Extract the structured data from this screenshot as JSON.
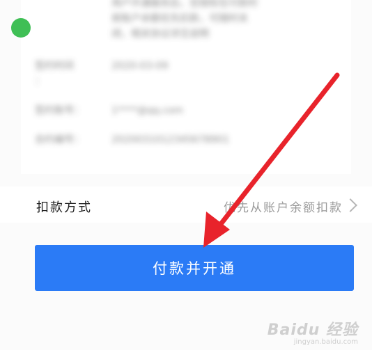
{
  "info_rows": [
    {
      "label": "",
      "value": "用户开通服务后，您授权在付款时\n按账户余额优先扣款，可随时关\n闭，相关协议详见说明"
    },
    {
      "label": "签约时间\n：",
      "value": "2020-03-09"
    },
    {
      "label": "签约账号：",
      "value": "1****@qq.com"
    },
    {
      "label": "合约编号：",
      "value": "2020031012345678901"
    }
  ],
  "deduct": {
    "label": "扣款方式",
    "value": "优先从账户余额扣款"
  },
  "pay_button": {
    "label": "付款并开通"
  },
  "watermark": {
    "main": "Baidu 经验",
    "sub": "jingyan.baidu.com"
  },
  "colors": {
    "accent": "#2b7bf6",
    "arrow": "#e8232b"
  }
}
